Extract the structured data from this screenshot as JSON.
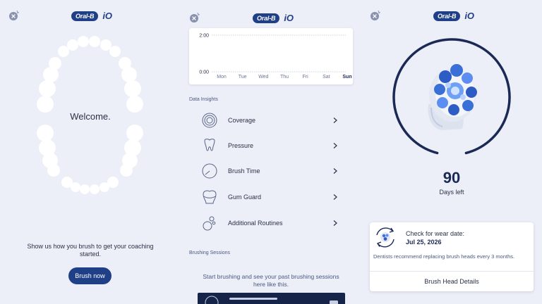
{
  "logo": {
    "badge": "Oral-B",
    "suffix": "iO"
  },
  "welcome_panel": {
    "title": "Welcome.",
    "coach_text": "Show us how you brush to get your coaching started.",
    "brush_button": "Brush now"
  },
  "insights_panel": {
    "chart_data": {
      "type": "line",
      "categories": [
        "Mon",
        "Tue",
        "Wed",
        "Thu",
        "Fri",
        "Sat",
        "Sun"
      ],
      "y_ticks": [
        "2:00",
        "0:00"
      ],
      "highlight": "Sun",
      "values": []
    },
    "section_insights": "Data Insights",
    "insights": [
      {
        "label": "Coverage",
        "icon": "coverage-icon"
      },
      {
        "label": "Pressure",
        "icon": "tooth-icon"
      },
      {
        "label": "Brush Time",
        "icon": "timer-icon"
      },
      {
        "label": "Gum Guard",
        "icon": "gum-icon"
      },
      {
        "label": "Additional Routines",
        "icon": "bubbles-icon"
      }
    ],
    "section_sessions": "Brushing Sessions",
    "sessions_empty": "Start brushing and see your past brushing sessions here like this."
  },
  "brush_head_panel": {
    "days": "90",
    "days_label": "Days left",
    "remaining_fraction": 0.92,
    "wear_title": "Check for wear date:",
    "wear_date": "Jul 25, 2026",
    "wear_desc": "Dentists recommend replacing brush heads every 3 months.",
    "details_link": "Brush Head Details"
  },
  "colors": {
    "brand": "#1f3f86",
    "background": "#eceef8",
    "ring": "#1a2a55"
  }
}
